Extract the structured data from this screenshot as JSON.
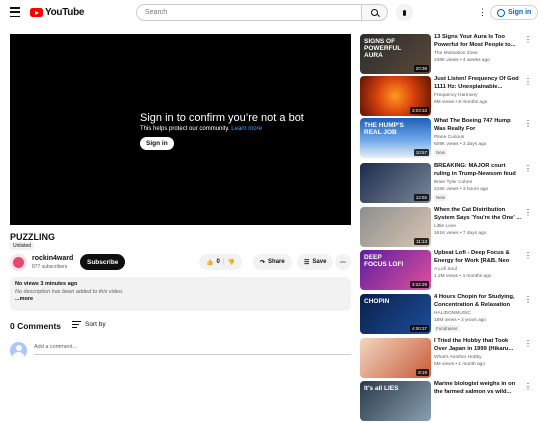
{
  "header": {
    "logo_text": "YouTube",
    "search_placeholder": "Search",
    "signin_label": "Sign in"
  },
  "player": {
    "message_title": "Sign in to confirm you’re not a bot",
    "message_sub": "This helps protect our community.",
    "learn_more": "Learn more",
    "signin_button": "Sign in"
  },
  "video": {
    "title": "PUZZLING",
    "unlisted": "Unlisted",
    "channel": "rockin4ward",
    "subscribers": "877 subscribers",
    "subscribe_label": "Subscribe",
    "likes": "0",
    "share_label": "Share",
    "save_label": "Save"
  },
  "description": {
    "meta": "No views  3 minutes ago",
    "text": "No description has been added to this video.",
    "more": "...more"
  },
  "comments": {
    "count_label": "0 Comments",
    "sort_label": "Sort by",
    "add_placeholder": "Add a comment..."
  },
  "related": [
    {
      "title": "13 Signs Your Aura Is Too Powerful for Most People to...",
      "channel": "The Motivation Zone",
      "meta": "248K views  •  4 weeks ago",
      "duration": "20:38",
      "badge": "",
      "thumb_text": "SIGNS OF POWERFUL AURA"
    },
    {
      "title": "Just Listen! Frequency Of God 1111 Hz: Unexplainable...",
      "channel": "Frequency Harmony",
      "meta": "9M views  •  8 months ago",
      "duration": "3:03:33",
      "badge": "",
      "thumb_text": ""
    },
    {
      "title": "What The Boeing 747 Hump Was Really For",
      "channel": "Plane Curious",
      "meta": "609K views  •  3 days ago",
      "duration": "10:57",
      "badge": "New",
      "thumb_text": "THE HUMP'S REAL JOB"
    },
    {
      "title": "BREAKING: MAJOR court ruling in Trump-Newsom feud",
      "channel": "Brian Tyler Cohen",
      "meta": "216K views  •  3 hours ago",
      "duration": "12:55",
      "badge": "New",
      "thumb_text": ""
    },
    {
      "title": "When the Cat Distribution System Says 'You're the One' ...",
      "channel": "Little Love",
      "meta": "161K views  •  7 days ago",
      "duration": "11:13",
      "badge": "",
      "thumb_text": ""
    },
    {
      "title": "Upbeat Lofi - Deep Focus & Energy for Work [R&B, Neo So...",
      "channel": "A Lofi Soul",
      "meta": "1.2M views  •  4 months ago",
      "duration": "3:22:29",
      "badge": "",
      "thumb_text": "DEEP FOCUS LOFI"
    },
    {
      "title": "4 Hours Chopin for Studying, Concentration & Relaxation",
      "channel": "HALIDONMUSIC",
      "meta": "18M views  •  3 years ago",
      "duration": "4:00:37",
      "badge": "Fundraiser",
      "thumb_text": "CHOPIN"
    },
    {
      "title": "I Tried the Hobby that Took Over Japan in 1999 (Hikaru...",
      "channel": "What's Another Hobby",
      "meta": "5M views  •  1 month ago",
      "duration": "8:19",
      "badge": "",
      "thumb_text": ""
    },
    {
      "title": "Marine biologist weighs in on the farmed salmon vs wild...",
      "channel": "",
      "meta": "",
      "duration": "",
      "badge": "",
      "thumb_text": "It's all LIES"
    }
  ]
}
